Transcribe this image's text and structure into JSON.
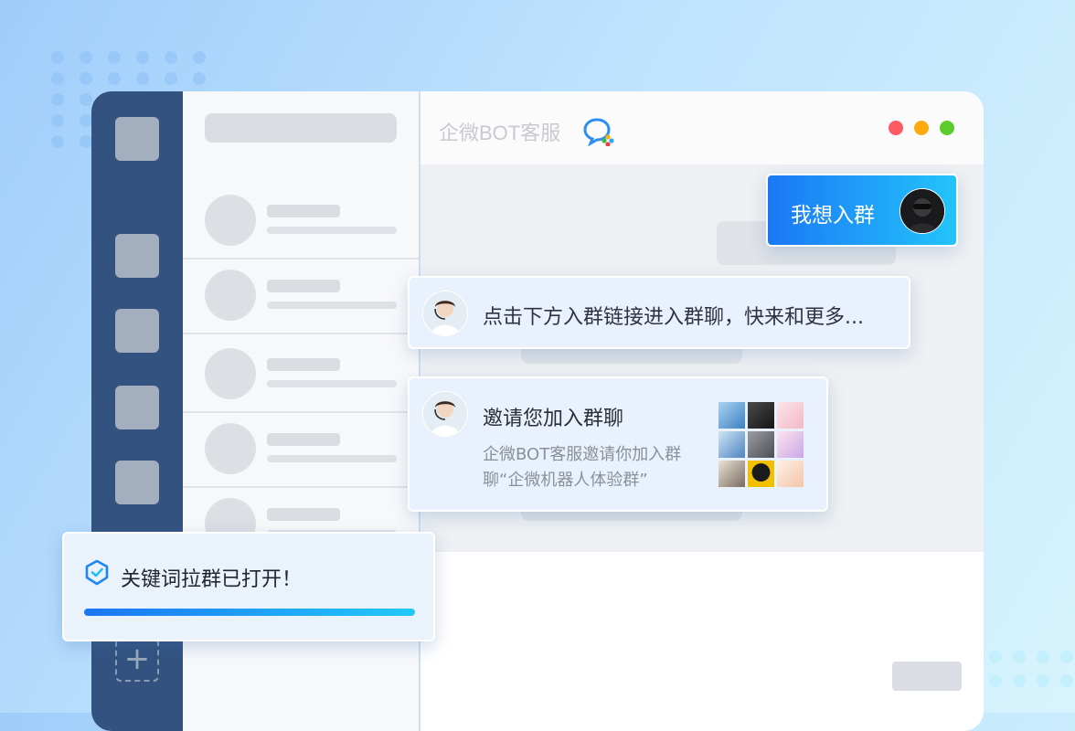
{
  "window": {
    "title": "企微BOT客服",
    "traffic_lights": {
      "close": "#fb5b61",
      "minimize": "#ffab0f",
      "maximize": "#5dcb2b"
    }
  },
  "sidebar": {
    "icons": [
      "app-placeholder-icon",
      "app-placeholder-icon",
      "app-placeholder-icon",
      "app-placeholder-icon",
      "app-placeholder-icon",
      "app-placeholder-icon"
    ],
    "add_label": "+"
  },
  "messages": {
    "user": {
      "text": "我想入群"
    },
    "bot_reply": {
      "text": "点击下方入群链接进入群聊，快来和更多..."
    },
    "invite_card": {
      "title": "邀请您加入群聊",
      "description": "企微BOT客服邀请你加入群聊“企微机器人体验群”"
    }
  },
  "toast": {
    "text": "关键词拉群已打开！",
    "progress": 1.0
  },
  "colors": {
    "accent_start": "#1b78f5",
    "accent_end": "#23c4fa",
    "sidebar_bg": "#33527f"
  }
}
